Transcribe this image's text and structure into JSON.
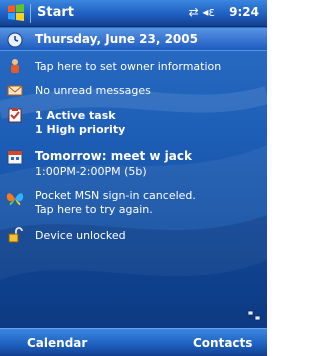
{
  "titlebar": {
    "title": "Start",
    "status_icons": "⇄ ◂ε",
    "time": "9:24"
  },
  "today": {
    "date": "Thursday, June 23, 2005",
    "owner": "Tap here to set owner information",
    "messages": "No unread messages",
    "tasks_line1": "1 Active task",
    "tasks_line2": "1 High priority",
    "appointment_title": "Tomorrow: meet w jack",
    "appointment_time": "1:00PM-2:00PM (5b)",
    "msn_line1": "Pocket MSN sign-in canceled.",
    "msn_line2": "Tap here to try again.",
    "device": "Device unlocked"
  },
  "softkeys": {
    "left": "Calendar",
    "right": "Contacts"
  },
  "colors": {
    "accent": "#1e5fb8",
    "text": "#ffffff"
  }
}
